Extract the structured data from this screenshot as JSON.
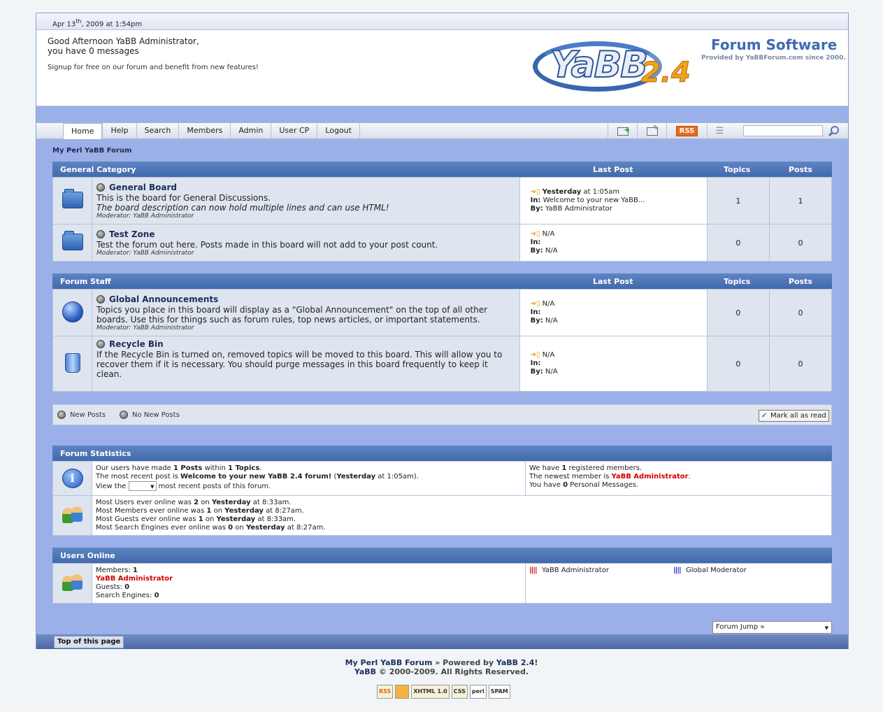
{
  "date": {
    "prefix": "Apr 13",
    "sup": "th",
    "suffix": ", 2009 at 1:54pm"
  },
  "header": {
    "greeting_line1": "Good Afternoon YaBB Administrator,",
    "greeting_line2": "you have 0 messages",
    "signup": "Signup for free on our forum and benefit from new features!"
  },
  "logo": {
    "name": "YaBB",
    "version": "2.4",
    "tagline": "Forum Software",
    "provided": "Provided by YaBBForum.com since 2000."
  },
  "nav": {
    "tabs": [
      "Home",
      "Help",
      "Search",
      "Members",
      "Admin",
      "User CP",
      "Logout"
    ],
    "rss": "RSS"
  },
  "breadcrumb": "My Perl YaBB Forum",
  "categories": [
    {
      "name": "General Category",
      "col_last": "Last Post",
      "col_topics": "Topics",
      "col_posts": "Posts",
      "boards": [
        {
          "name": "General Board",
          "desc1": "This is the board for General Discussions.",
          "desc2": "The board description can now hold multiple lines and can use HTML!",
          "moderator": "Moderator: YaBB Administrator",
          "last_when": "Yesterday",
          "last_time": " at 1:05am",
          "last_in": "Welcome to your new YaBB...",
          "last_by": "YaBB Administrator",
          "topics": "1",
          "posts": "1"
        },
        {
          "name": "Test Zone",
          "desc1": "Test the forum out here. Posts made in this board will not add to your post count.",
          "moderator": "Moderator: YaBB Administrator",
          "last_when": "N/A",
          "last_in": "",
          "last_by": "N/A",
          "topics": "0",
          "posts": "0"
        }
      ]
    },
    {
      "name": "Forum Staff",
      "col_last": "Last Post",
      "col_topics": "Topics",
      "col_posts": "Posts",
      "boards": [
        {
          "name": "Global Announcements",
          "desc1": "Topics you place in this board will display as a \"Global Announcement\" on the top of all other boards. Use this for things such as forum rules, top news articles, or important statements.",
          "moderator": "Moderator: YaBB Administrator",
          "last_when": "N/A",
          "last_in": "",
          "last_by": "N/A",
          "topics": "0",
          "posts": "0"
        },
        {
          "name": "Recycle Bin",
          "desc1": "If the Recycle Bin is turned on, removed topics will be moved to this board. This will allow you to recover them if it is necessary. You should purge messages in this board frequently to keep it clean.",
          "last_when": "N/A",
          "last_in": "",
          "last_by": "N/A",
          "topics": "0",
          "posts": "0"
        }
      ]
    }
  ],
  "labels": {
    "in": "In:",
    "by": "By:"
  },
  "legend": {
    "new": "New Posts",
    "nonew": "No New Posts",
    "mark_all": "Mark all as read"
  },
  "stats": {
    "title": "Forum Statistics",
    "l1a": "Our users have made ",
    "posts": "1 Posts",
    "l1b": " within ",
    "topics": "1 Topics",
    "l1c": ".",
    "l2a": "The most recent post is ",
    "recent": "Welcome to your new YaBB 2.4 forum!",
    "l2b": " (",
    "recent_when": "Yesterday",
    "l2c": " at 1:05am).",
    "l3a": "View the ",
    "l3b": " most recent posts of this forum.",
    "r1a": "We have ",
    "r1n": "1",
    "r1b": " registered members.",
    "r2a": "The newest member is ",
    "r2n": "YaBB Administrator",
    "r2b": ".",
    "r3a": "You have ",
    "r3n": "0",
    "r3b": " Personal Messages.",
    "o1a": "Most Users ever online was ",
    "o1n": "2",
    "o1b": " on ",
    "o1d": "Yesterday",
    "o1c": " at 8:33am.",
    "o2a": "Most Members ever online was ",
    "o2n": "1",
    "o2b": " on ",
    "o2d": "Yesterday",
    "o2c": " at 8:27am.",
    "o3a": "Most Guests ever online was ",
    "o3n": "1",
    "o3b": " on ",
    "o3d": "Yesterday",
    "o3c": " at 8:33am.",
    "o4a": "Most Search Engines ever online was ",
    "o4n": "0",
    "o4b": " on ",
    "o4d": "Yesterday",
    "o4c": " at 8:27am."
  },
  "online": {
    "title": "Users Online",
    "members_label": "Members: ",
    "members": "1",
    "member_name": "YaBB Administrator",
    "guests_label": "Guests: ",
    "guests": "0",
    "se_label": "Search Engines: ",
    "se": "0",
    "legend_admin": "YaBB Administrator",
    "legend_gmod": "Global Moderator",
    "color_admin": "#d40000",
    "color_gmod": "#2020d0"
  },
  "forum_jump": "Forum Jump »",
  "top_link": "Top of this page",
  "footer": {
    "site": "My Perl YaBB Forum",
    "powered": " » Powered by ",
    "yabb_ver": "YaBB 2.4",
    "bang": "!",
    "line2_a": "YaBB",
    "line2_b": " © 2000-2009. All Rights Reserved."
  },
  "badges": [
    "RSS",
    "XHTML 1.0",
    "CSS",
    "perl",
    "SPAM"
  ]
}
